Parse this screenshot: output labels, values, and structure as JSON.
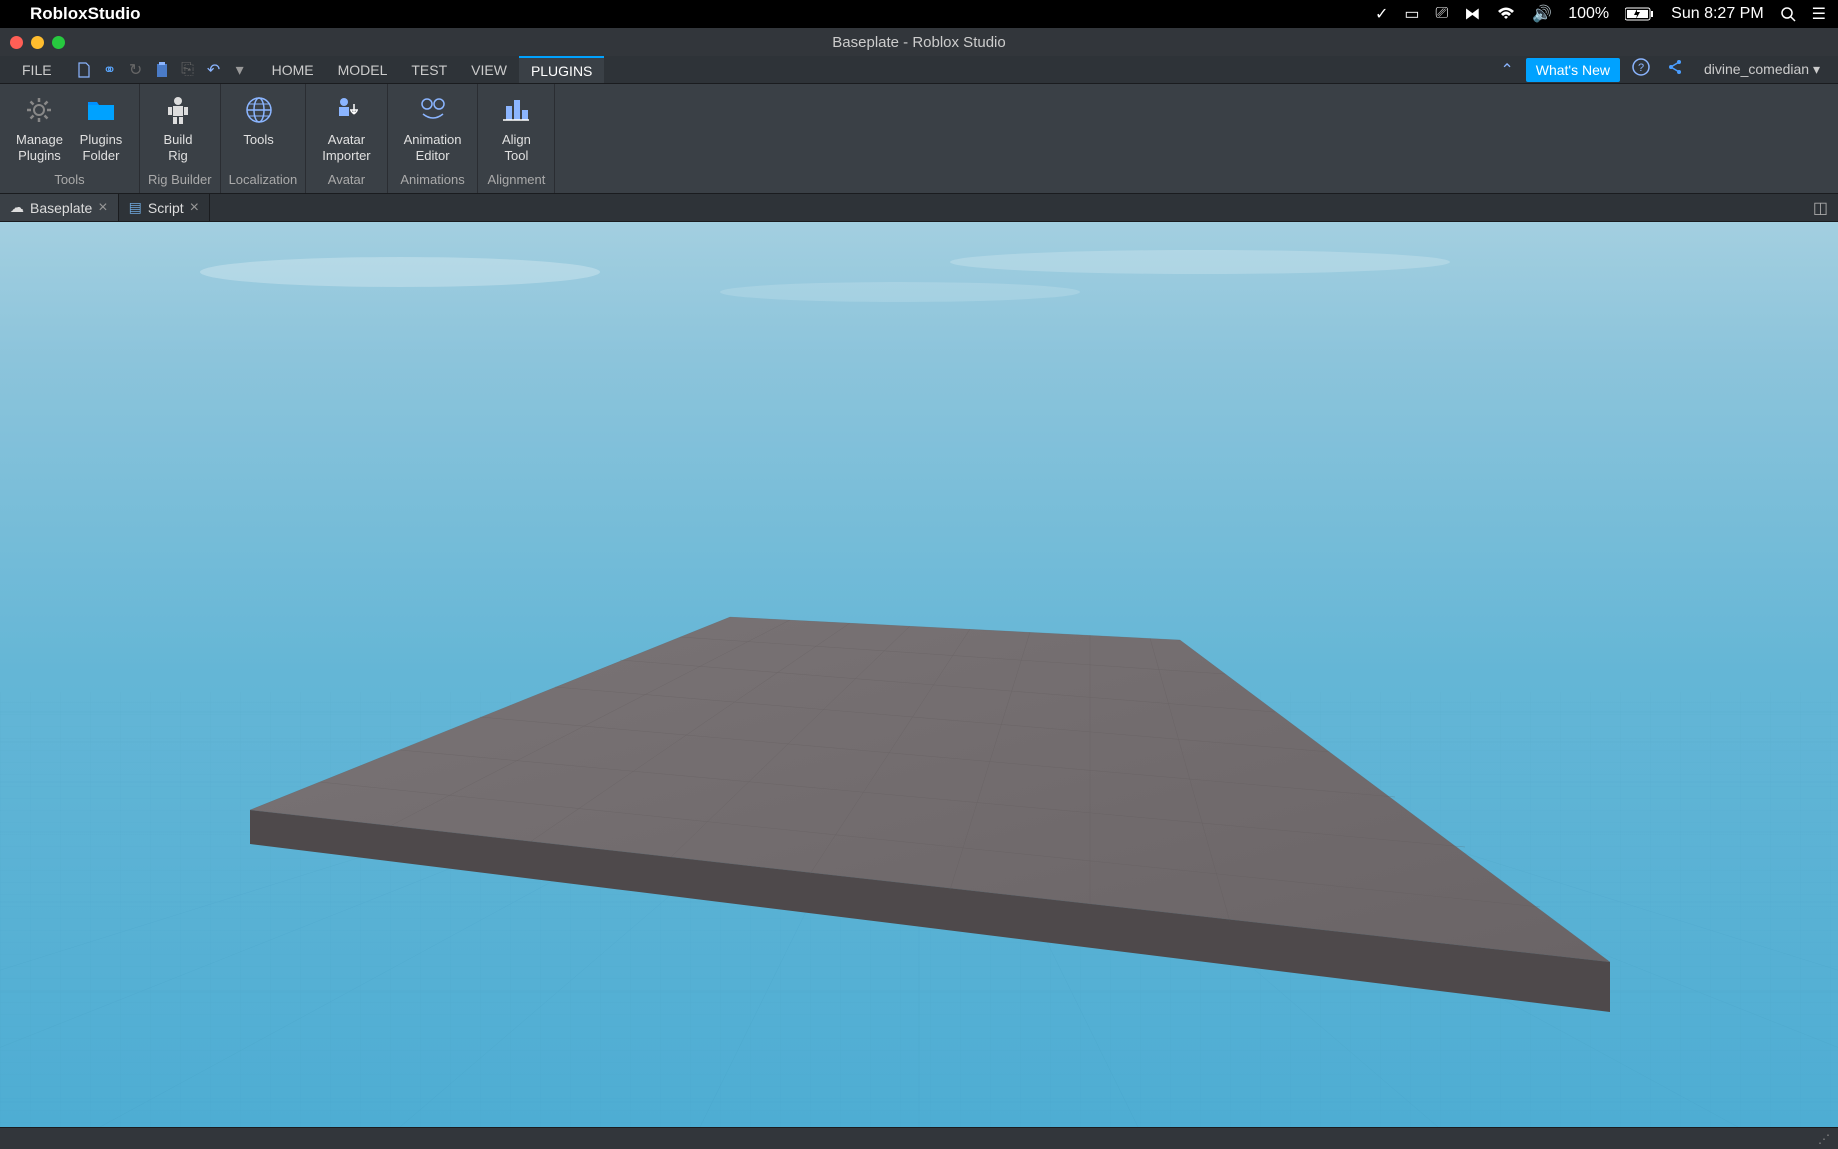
{
  "macos": {
    "app_name": "RobloxStudio",
    "battery": "100%",
    "datetime": "Sun 8:27 PM"
  },
  "window": {
    "title": "Baseplate - Roblox Studio"
  },
  "ribbon": {
    "file": "FILE",
    "tabs": [
      "HOME",
      "MODEL",
      "TEST",
      "VIEW",
      "PLUGINS"
    ],
    "active_tab": "PLUGINS",
    "whats_new": "What's New",
    "username": "divine_comedian"
  },
  "tools": {
    "groups": [
      {
        "label": "Tools",
        "buttons": [
          {
            "line1": "Manage",
            "line2": "Plugins"
          },
          {
            "line1": "Plugins",
            "line2": "Folder"
          }
        ]
      },
      {
        "label": "Rig Builder",
        "buttons": [
          {
            "line1": "Build",
            "line2": "Rig"
          }
        ]
      },
      {
        "label": "Localization",
        "buttons": [
          {
            "line1": "Tools",
            "line2": ""
          }
        ]
      },
      {
        "label": "Avatar",
        "buttons": [
          {
            "line1": "Avatar",
            "line2": "Importer"
          }
        ]
      },
      {
        "label": "Animations",
        "buttons": [
          {
            "line1": "Animation",
            "line2": "Editor"
          }
        ]
      },
      {
        "label": "Alignment",
        "buttons": [
          {
            "line1": "Align",
            "line2": "Tool"
          }
        ]
      }
    ]
  },
  "doc_tabs": [
    {
      "label": "Baseplate",
      "icon": "cloud",
      "active": true
    },
    {
      "label": "Script",
      "icon": "script",
      "active": false
    }
  ]
}
